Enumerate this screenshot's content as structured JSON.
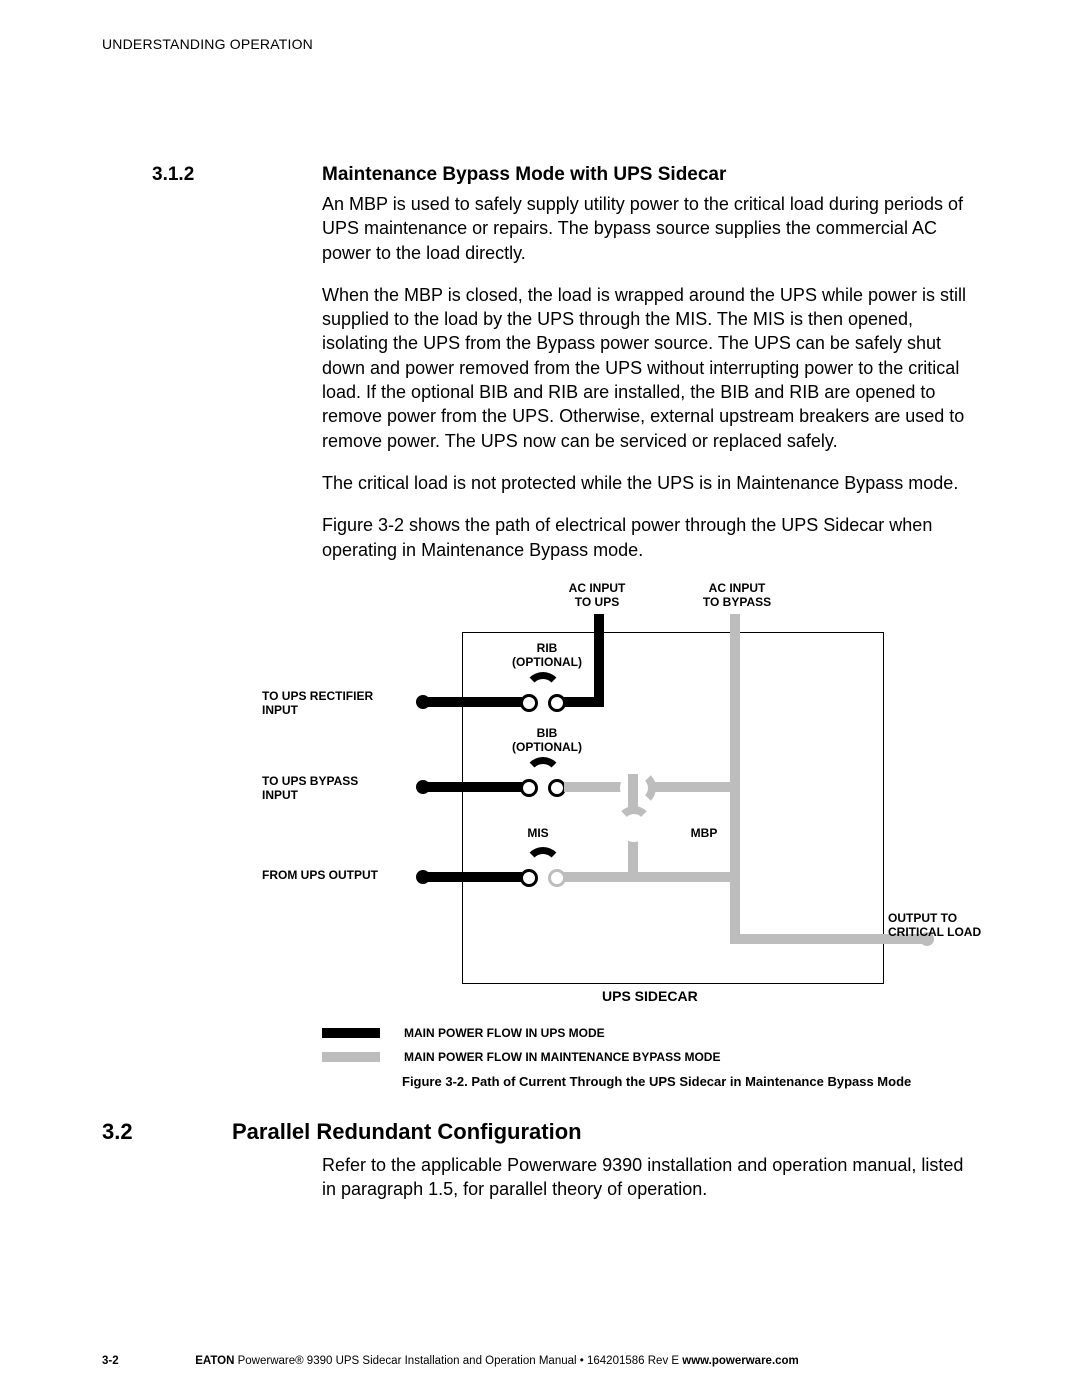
{
  "header": "UNDERSTANDING OPERATION",
  "section312": {
    "num": "3.1.2",
    "title": "Maintenance Bypass Mode with UPS Sidecar",
    "p1": "An MBP is used to safely supply utility power to the critical load during periods of UPS maintenance or repairs. The bypass source supplies the commercial AC power to the load directly.",
    "p2": "When the MBP is closed, the load is wrapped around the UPS while power is still supplied to the load by the UPS through the MIS. The MIS is then opened, isolating the UPS from the Bypass power source. The UPS can be safely shut down and power removed from the UPS without interrupting power to the critical load. If the optional BIB and RIB are installed, the BIB and RIB are opened to remove power from the UPS. Otherwise, external upstream breakers are used to remove power. The UPS now can be serviced or replaced safely.",
    "p3": "The critical load is not protected while the UPS is in Maintenance Bypass mode.",
    "p4": "Figure 3‑2 shows the path of electrical power through the UPS Sidecar when operating in Maintenance Bypass mode."
  },
  "diagram": {
    "labels": {
      "ac_input_ups": "AC INPUT\nTO UPS",
      "ac_input_bypass": "AC INPUT\nTO BYPASS",
      "rib": "RIB\n(OPTIONAL)",
      "bib": "BIB\n(OPTIONAL)",
      "mis": "MIS",
      "mbp": "MBP",
      "to_ups_rect": "TO UPS RECTIFIER\nINPUT",
      "to_ups_byp": "TO UPS BYPASS\nINPUT",
      "from_ups_out": "FROM UPS OUTPUT",
      "output_crit": "OUTPUT TO\nCRITICAL LOAD",
      "box": "UPS SIDECAR"
    },
    "legend": {
      "black": "MAIN POWER FLOW IN UPS MODE",
      "gray": "MAIN POWER FLOW IN MAINTENANCE BYPASS MODE"
    },
    "caption": "Figure 3‑2. Path of Current Through the UPS Sidecar in Maintenance Bypass Mode"
  },
  "section32": {
    "num": "3.2",
    "title": "Parallel Redundant Configuration",
    "p1": "Refer to the applicable Powerware 9390 installation and operation manual, listed in paragraph 1.5, for parallel theory of operation."
  },
  "footer": {
    "pagenum": "3-2",
    "company": "EATON",
    "manual": " Powerware® 9390 UPS Sidecar Installation and Operation Manual  •  164201586 Rev E ",
    "url": "www.powerware.com"
  }
}
